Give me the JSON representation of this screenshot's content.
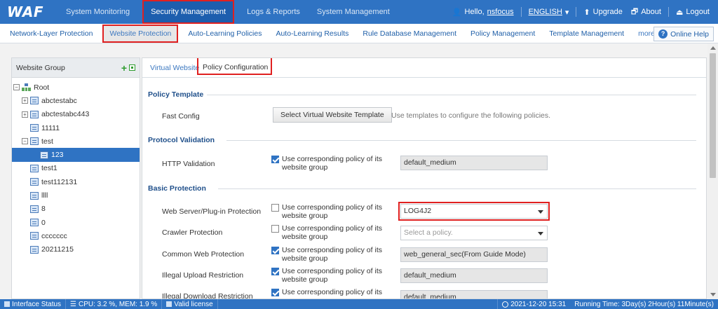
{
  "app": {
    "logo": "WAF"
  },
  "topnav": {
    "items": [
      "System Monitoring",
      "Security Management",
      "Logs & Reports",
      "System Management"
    ],
    "greeting": "Hello,",
    "user": "nsfocus",
    "language": "ENGLISH",
    "upgrade": "Upgrade",
    "about": "About",
    "logout": "Logout"
  },
  "subnav": {
    "items": [
      "Network-Layer Protection",
      "Website Protection",
      "Auto-Learning Policies",
      "Auto-Learning Results",
      "Rule Database Management",
      "Policy Management",
      "Template Management"
    ],
    "more": "more",
    "help": "Online Help"
  },
  "left": {
    "title": "Website Group",
    "tree": [
      {
        "label": "Root",
        "level": 0,
        "expander": "⊟",
        "kind": "root"
      },
      {
        "label": "abctestabc",
        "level": 1,
        "expander": "⊞"
      },
      {
        "label": "abctestabc443",
        "level": 1,
        "expander": "⊞"
      },
      {
        "label": "11111",
        "level": 1,
        "expander": ""
      },
      {
        "label": "test",
        "level": 1,
        "expander": "⊟"
      },
      {
        "label": "123",
        "level": 2,
        "expander": "",
        "selected": true
      },
      {
        "label": "test1",
        "level": 1,
        "expander": ""
      },
      {
        "label": "test112131",
        "level": 1,
        "expander": ""
      },
      {
        "label": "llll",
        "level": 1,
        "expander": ""
      },
      {
        "label": "8",
        "level": 1,
        "expander": ""
      },
      {
        "label": "0",
        "level": 1,
        "expander": ""
      },
      {
        "label": "ccccccc",
        "level": 1,
        "expander": ""
      },
      {
        "label": "20211215",
        "level": 1,
        "expander": ""
      }
    ]
  },
  "main": {
    "tabs": [
      "Virtual Website",
      "Policy Configuration"
    ],
    "policy_template": {
      "title": "Policy Template",
      "label": "Fast Config",
      "button": "Select Virtual Website Template",
      "hint": "Use templates to configure the following policies."
    },
    "protocol": {
      "title": "Protocol Validation",
      "label": "HTTP Validation",
      "check": "Use corresponding policy of its website group",
      "value": "default_medium"
    },
    "basic": {
      "title": "Basic Protection",
      "rows": [
        {
          "label": "Web Server/Plug-in Protection",
          "check": "Use corresponding policy of its website group",
          "value": "LOG4J2"
        },
        {
          "label": "Crawler Protection",
          "check": "Use corresponding policy of its website group",
          "value": "Select a policy."
        },
        {
          "label": "Common Web Protection",
          "check": "Use corresponding policy of its website group",
          "value": "web_general_sec(From Guide Mode)"
        },
        {
          "label": "Illegal Upload Restriction",
          "check": "Use corresponding policy of its website group",
          "value": "default_medium"
        },
        {
          "label": "Illegal Download Restriction",
          "check": "Use corresponding policy of its",
          "value": "default_medium"
        }
      ]
    }
  },
  "status": {
    "interface": "Interface Status",
    "cpu": "CPU:  3.2 %, MEM:  1.9 %",
    "license": "Valid license",
    "datetime": "2021-12-20 15:31",
    "runtime": "Running Time:  3Day(s) 2Hour(s) 11Minute(s)"
  }
}
